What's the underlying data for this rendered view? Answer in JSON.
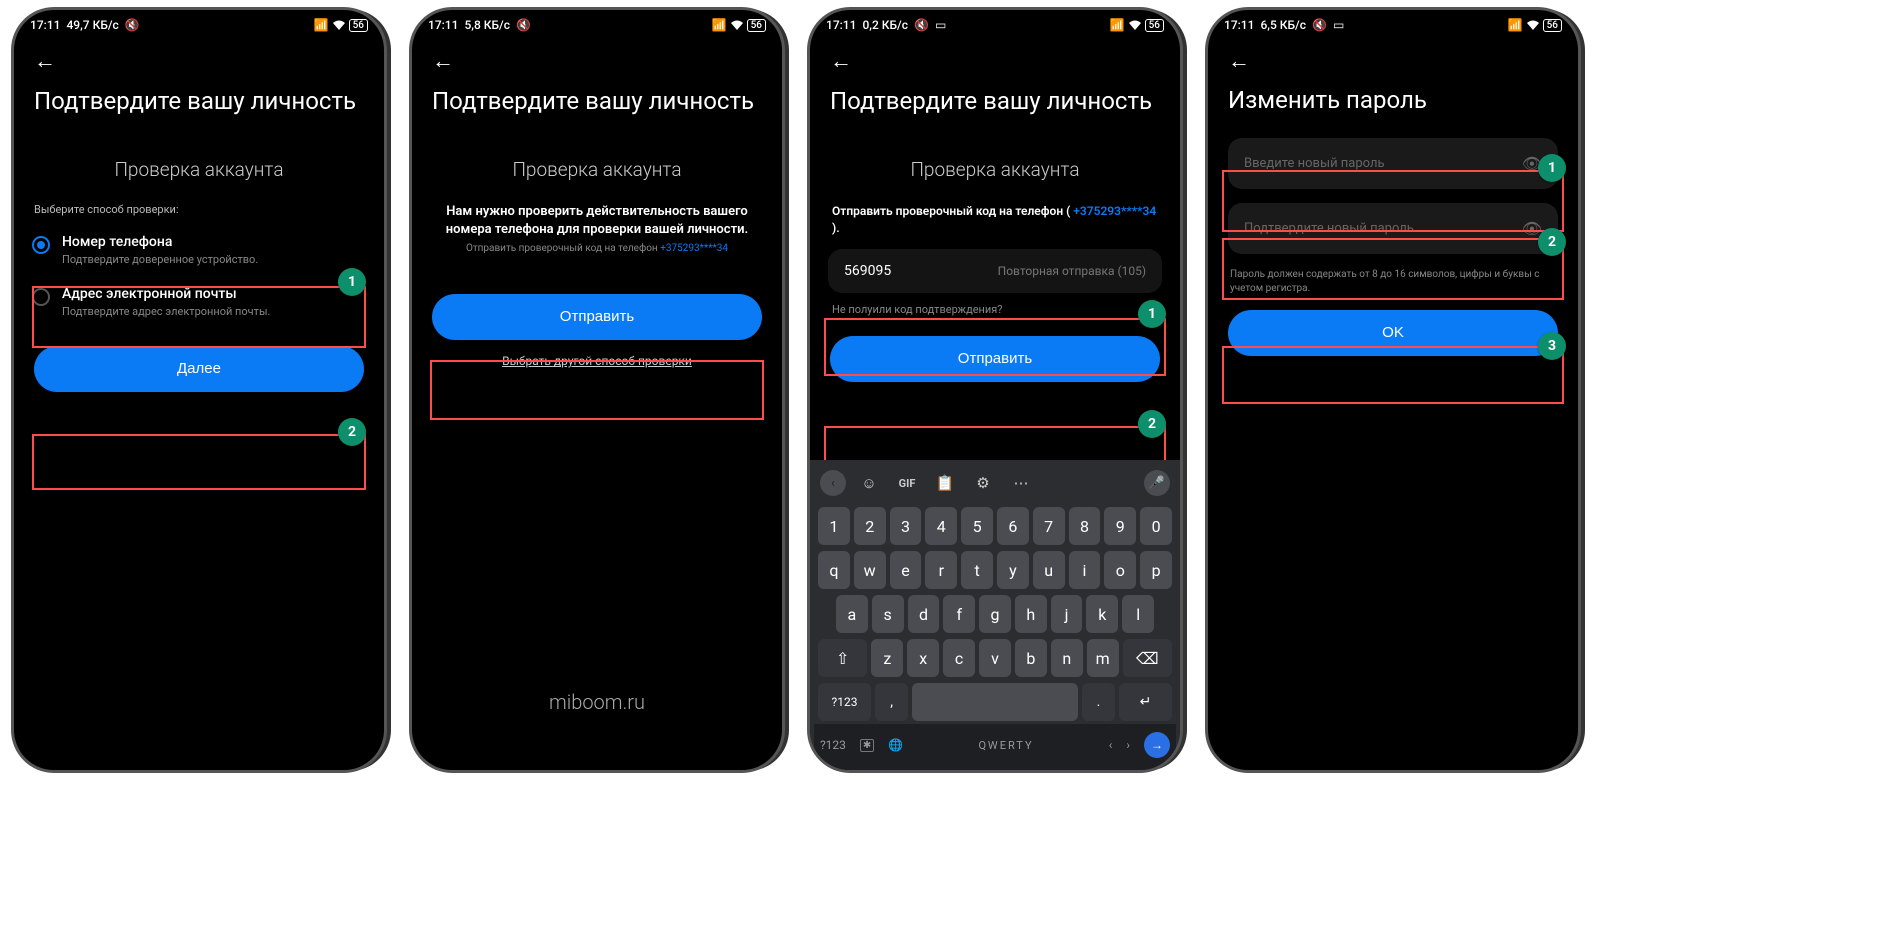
{
  "screens": {
    "s1": {
      "status": {
        "time": "17:11",
        "speed": "49,7 КБ/с",
        "battery": "56"
      },
      "title": "Подтвердите вашу личность",
      "subtitle": "Проверка аккаунта",
      "select_label": "Выберите способ проверки:",
      "opt_phone_title": "Номер телефона",
      "opt_phone_sub": "Подтвердите доверенное устройство.",
      "opt_email_title": "Адрес электронной почты",
      "opt_email_sub": "Подтвердите адрес электронной почты.",
      "next_btn": "Далее",
      "badge1": "1",
      "badge2": "2"
    },
    "s2": {
      "status": {
        "time": "17:11",
        "speed": "5,8 КБ/с",
        "battery": "56"
      },
      "title": "Подтвердите вашу личность",
      "subtitle": "Проверка аккаунта",
      "info_bold": "Нам нужно проверить действительность вашего номера телефона для проверки вашей личности.",
      "info_small_prefix": "Отправить проверочный код на телефон ",
      "info_small_phone": "+375293****34",
      "send_btn": "Отправить",
      "other_link": "Выбрать другой способ проверки",
      "brand": "miboom.ru"
    },
    "s3": {
      "status": {
        "time": "17:11",
        "speed": "0,2 КБ/с",
        "battery": "56"
      },
      "title": "Подтвердите вашу личность",
      "subtitle": "Проверка аккаунта",
      "send_line_prefix": "Отправить проверочный код на телефон ( ",
      "send_line_phone": "+375293****34",
      "send_line_suffix": " ).",
      "code_value": "569095",
      "resend": "Повторная отправка (105)",
      "no_code": "Не полуили код подтверждения?",
      "send_btn": "Отправить",
      "badge1": "1",
      "badge2": "2",
      "kb": {
        "num": [
          "1",
          "2",
          "3",
          "4",
          "5",
          "6",
          "7",
          "8",
          "9",
          "0"
        ],
        "r1": [
          "q",
          "w",
          "e",
          "r",
          "t",
          "y",
          "u",
          "i",
          "o",
          "p"
        ],
        "r2": [
          "a",
          "s",
          "d",
          "f",
          "g",
          "h",
          "j",
          "k",
          "l"
        ],
        "r3": [
          "z",
          "x",
          "c",
          "v",
          "b",
          "n",
          "m"
        ],
        "shift": "⇧",
        "bksp": "⌫",
        "numkey": "?123",
        "comma": ",",
        "space": "QWERTY",
        "dot": ".",
        "go": "→",
        "gif": "GIF"
      }
    },
    "s4": {
      "status": {
        "time": "17:11",
        "speed": "6,5 КБ/с",
        "battery": "56"
      },
      "title": "Изменить пароль",
      "pw1_ph": "Введите новый пароль",
      "pw2_ph": "Подтвердите новый пароль",
      "hint": "Пароль должен содержать от 8 до 16 символов, цифры и буквы с учетом регистра.",
      "ok_btn": "OK",
      "badge1": "1",
      "badge2": "2",
      "badge3": "3"
    }
  }
}
